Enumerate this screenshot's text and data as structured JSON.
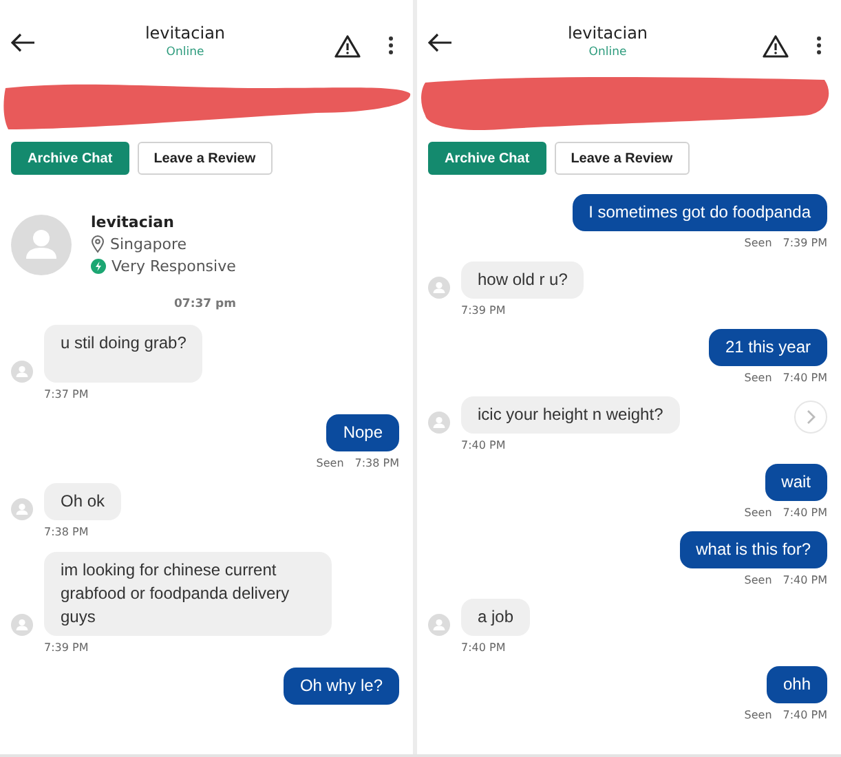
{
  "panels": [
    {
      "header": {
        "title": "levitacian",
        "status": "Online"
      },
      "buttons": [
        {
          "label": "Archive Chat",
          "kind": "primary"
        },
        {
          "label": "Leave a Review",
          "kind": "secondary"
        }
      ],
      "profile": {
        "name": "levitacian",
        "location": "Singapore",
        "badge": "Very Responsive"
      },
      "messages": [
        {
          "kind": "date",
          "text": "07:37 pm"
        },
        {
          "kind": "received",
          "text": "u stil doing grab?",
          "time": "7:37 PM"
        },
        {
          "kind": "sent",
          "text": "Nope",
          "seen": "Seen",
          "time": "7:38 PM"
        },
        {
          "kind": "received",
          "text": "Oh ok",
          "time": "7:38 PM"
        },
        {
          "kind": "received",
          "text": "im looking for chinese current grabfood or foodpanda delivery guys",
          "time": "7:39 PM"
        },
        {
          "kind": "sent",
          "text": "Oh why le?"
        }
      ]
    },
    {
      "header": {
        "title": "levitacian",
        "status": "Online"
      },
      "buttons": [
        {
          "label": "Archive Chat",
          "kind": "primary"
        },
        {
          "label": "Leave a Review",
          "kind": "secondary"
        }
      ],
      "messages": [
        {
          "kind": "sent",
          "text": "I sometimes got do foodpanda",
          "seen": "Seen",
          "time": "7:39 PM"
        },
        {
          "kind": "received",
          "text": "how old r u?",
          "time": "7:39 PM"
        },
        {
          "kind": "sent",
          "text": "21 this year",
          "seen": "Seen",
          "time": "7:40 PM"
        },
        {
          "kind": "received",
          "text": "icic your height n weight?",
          "time": "7:40 PM",
          "jump_button": true
        },
        {
          "kind": "sent",
          "text": "wait",
          "seen": "Seen",
          "time": "7:40 PM"
        },
        {
          "kind": "sent",
          "text": "what is this for?",
          "seen": "Seen",
          "time": "7:40 PM"
        },
        {
          "kind": "received",
          "text": "a job",
          "time": "7:40 PM"
        },
        {
          "kind": "sent",
          "text": "ohh",
          "seen": "Seen",
          "time": "7:40 PM"
        }
      ]
    }
  ]
}
